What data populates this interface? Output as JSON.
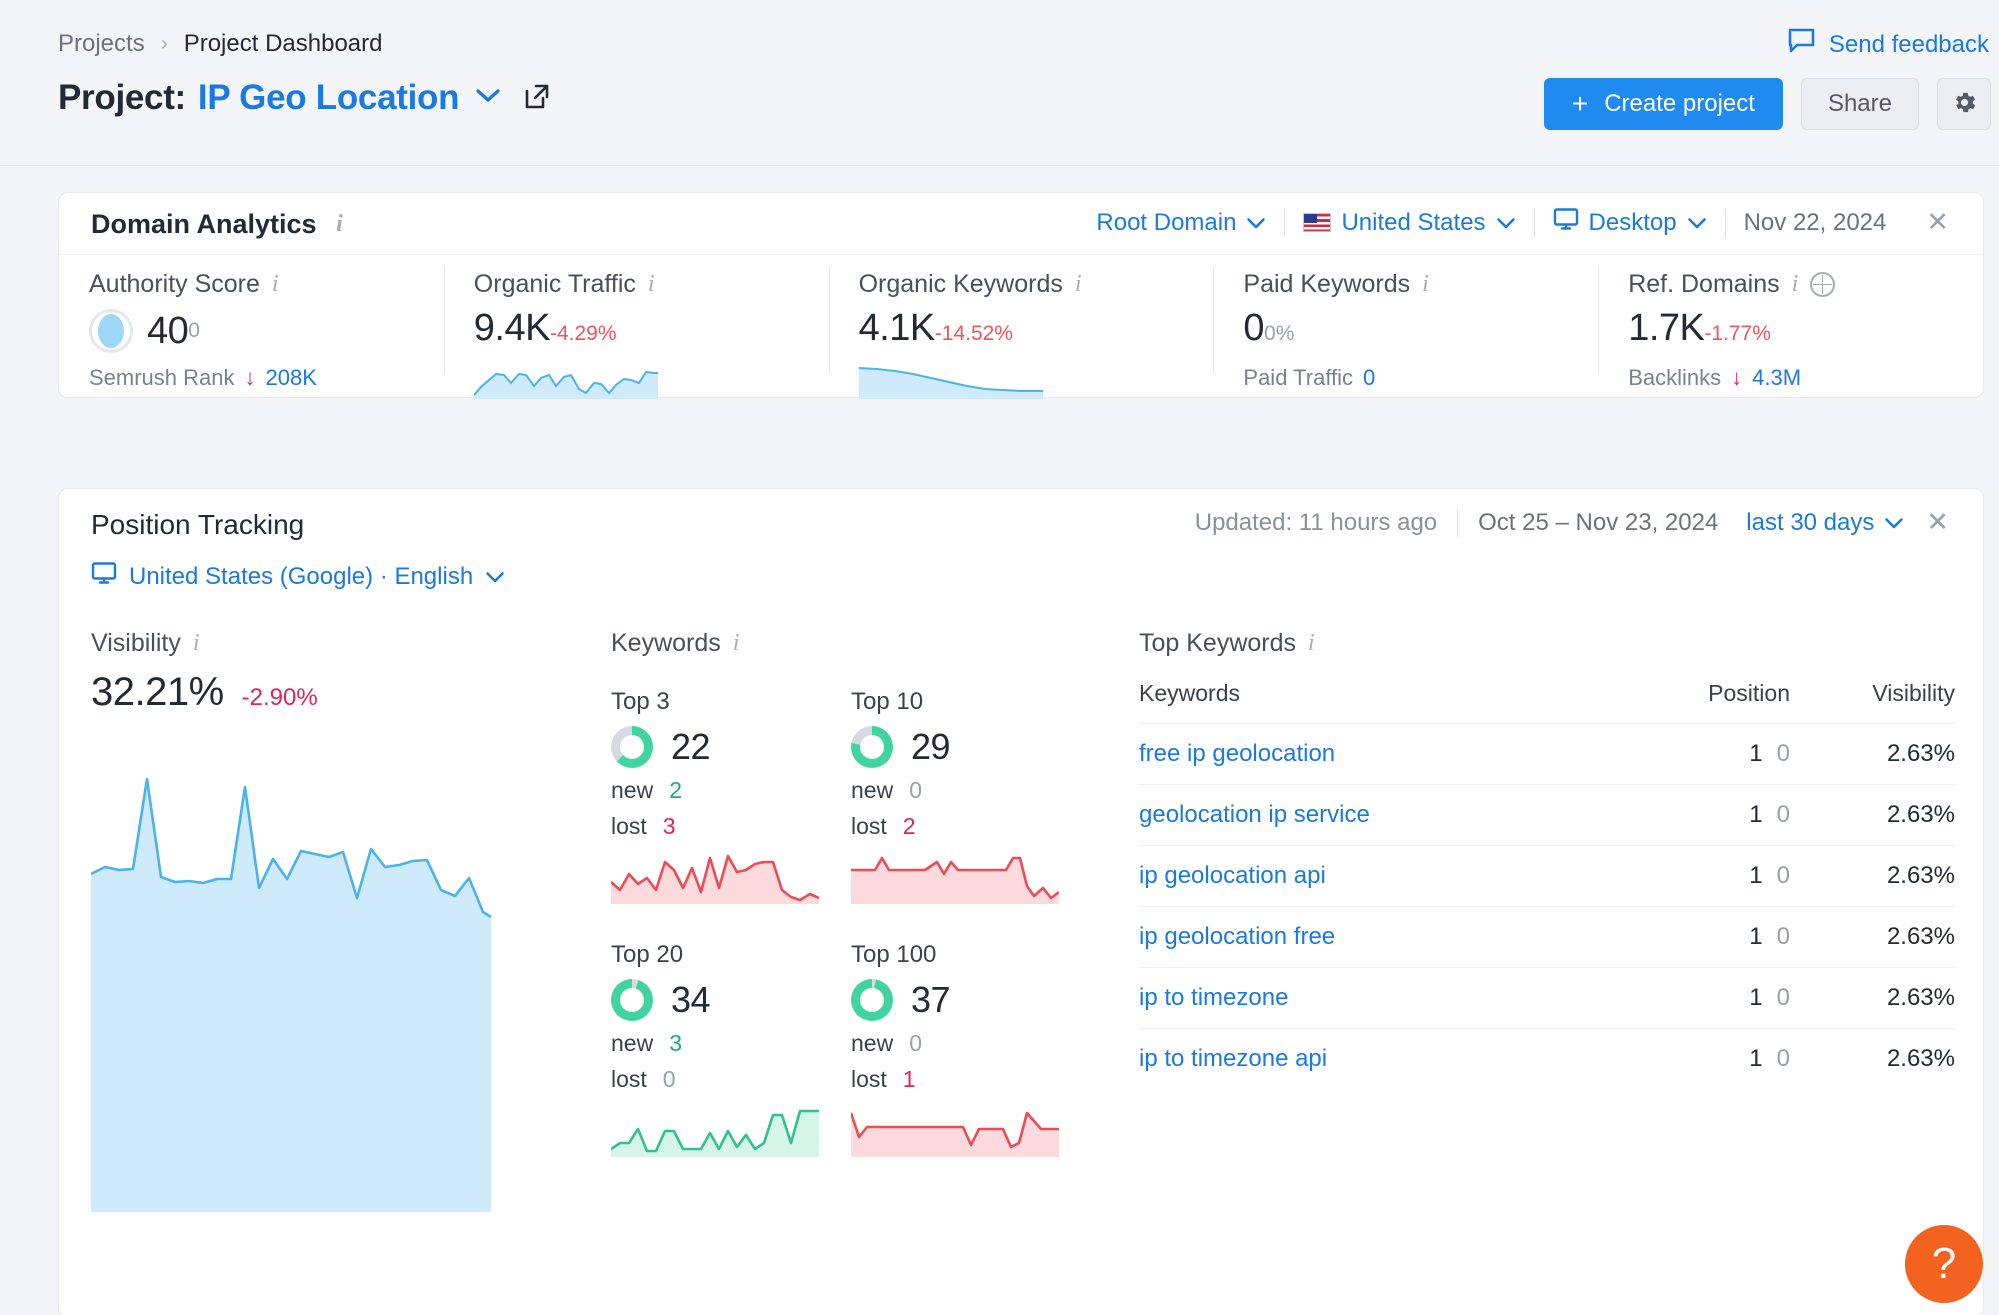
{
  "header": {
    "breadcrumb": {
      "root": "Projects",
      "separator": "›",
      "current": "Project Dashboard"
    },
    "title_prefix": "Project:",
    "project_name": "IP Geo Location",
    "caret_icon": "chevron-down-icon",
    "external_link_icon": "external-link-icon",
    "feedback_label": "Send feedback",
    "feedback_icon": "speech-bubble-icon",
    "create_project_label": "Create project",
    "create_plus": "+",
    "share_label": "Share",
    "gear_icon": "gear-icon",
    "accent_blue": "#1f8af0"
  },
  "domain_analytics": {
    "title": "Domain Analytics",
    "info_icon": "info-icon",
    "controls": {
      "scope": "Root Domain",
      "country": "United States",
      "country_flag": "us-flag-icon",
      "device": "Desktop",
      "device_icon": "monitor-icon",
      "date": "Nov 22, 2024",
      "close_icon": "close-icon"
    },
    "metrics": [
      {
        "label": "Authority Score",
        "value": "40",
        "sub": "0",
        "sub_kind": "grey",
        "gauge": true,
        "foot_label": "Semrush Rank",
        "foot_arrow": "↓",
        "foot_value": "208K",
        "sparkline": null
      },
      {
        "label": "Organic Traffic",
        "value": "9.4K",
        "sub": "-4.29%",
        "sub_kind": "neg",
        "gauge": false,
        "foot_label": "",
        "foot_value": "",
        "sparkline": "organic-traffic-sparkline"
      },
      {
        "label": "Organic Keywords",
        "value": "4.1K",
        "sub": "-14.52%",
        "sub_kind": "neg",
        "gauge": false,
        "foot_label": "",
        "foot_value": "",
        "sparkline": "organic-keywords-sparkline"
      },
      {
        "label": "Paid Keywords",
        "value": "0",
        "sub": "0%",
        "sub_kind": "grey",
        "gauge": false,
        "foot_label": "Paid Traffic",
        "foot_arrow": "",
        "foot_value": "0",
        "sparkline": null
      },
      {
        "label": "Ref. Domains",
        "value": "1.7K",
        "sub": "-1.77%",
        "sub_kind": "neg",
        "gauge": false,
        "foot_label": "Backlinks",
        "foot_arrow": "↓",
        "foot_value": "4.3M",
        "sparkline": null,
        "extra_icon": "globe-icon"
      }
    ]
  },
  "position_tracking": {
    "title": "Position Tracking",
    "engine": "United States (Google) · English",
    "engine_icon": "monitor-icon",
    "updated": "Updated: 11 hours ago",
    "date_range": "Oct 25 – Nov 23, 2024",
    "period": "last 30 days",
    "close_icon": "close-icon",
    "visibility": {
      "label": "Visibility",
      "value": "32.21%",
      "delta": "-2.90%"
    },
    "keywords": {
      "label": "Keywords",
      "buckets": [
        {
          "label": "Top 3",
          "count": "22",
          "new": "2",
          "lost": "3",
          "donut_pct": 63,
          "spark": "red"
        },
        {
          "label": "Top 10",
          "count": "29",
          "new": "0",
          "lost": "2",
          "donut_pct": 78,
          "spark": "red"
        },
        {
          "label": "Top 20",
          "count": "34",
          "new": "3",
          "lost": "0",
          "donut_pct": 94,
          "spark": "green"
        },
        {
          "label": "Top 100",
          "count": "37",
          "new": "0",
          "lost": "1",
          "donut_pct": 97,
          "spark": "red"
        }
      ]
    },
    "top_keywords": {
      "label": "Top Keywords",
      "columns": [
        "Keywords",
        "Position",
        "Visibility"
      ],
      "rows": [
        {
          "keyword": "free ip geolocation",
          "pos": "1",
          "pos_prev": "0",
          "visibility": "2.63%"
        },
        {
          "keyword": "geolocation ip service",
          "pos": "1",
          "pos_prev": "0",
          "visibility": "2.63%"
        },
        {
          "keyword": "ip geolocation api",
          "pos": "1",
          "pos_prev": "0",
          "visibility": "2.63%"
        },
        {
          "keyword": "ip geolocation free",
          "pos": "1",
          "pos_prev": "0",
          "visibility": "2.63%"
        },
        {
          "keyword": "ip to timezone",
          "pos": "1",
          "pos_prev": "0",
          "visibility": "2.63%"
        },
        {
          "keyword": "ip to timezone api",
          "pos": "1",
          "pos_prev": "0",
          "visibility": "2.63%"
        }
      ]
    }
  },
  "help": {
    "label": "?",
    "color": "#f4621f"
  },
  "chart_data": [
    {
      "type": "area",
      "title": "Visibility",
      "name": "visibility-trend",
      "ylabel": "Visibility %",
      "ylim": [
        0,
        45
      ],
      "values": [
        33.5,
        34.2,
        33.6,
        44.0,
        32.6,
        33.0,
        32.8,
        33.2,
        33.4,
        41.5,
        33.0,
        35.8,
        33.3,
        36.2,
        36.0,
        35.5,
        36.0,
        31.4,
        36.4,
        34.9,
        35.0,
        35.4,
        35.2,
        32.0,
        31.3,
        33.8,
        29.9,
        32.21
      ]
    },
    {
      "type": "area",
      "name": "organic-traffic-sparkline",
      "title": "Organic Traffic",
      "values": [
        22,
        40,
        58,
        72,
        70,
        48,
        72,
        70,
        44,
        66,
        70,
        40,
        64,
        68,
        34,
        26,
        48,
        46,
        26,
        44,
        58,
        56,
        50,
        76,
        74
      ]
    },
    {
      "type": "area",
      "name": "organic-keywords-sparkline",
      "title": "Organic Keywords",
      "values": [
        78,
        76,
        73,
        68,
        62,
        54,
        45,
        36,
        28,
        22,
        20,
        19,
        18,
        18,
        17
      ]
    },
    {
      "type": "area",
      "name": "top3-sparkline",
      "title": "Top 3",
      "values": [
        30,
        22,
        40,
        28,
        34,
        22,
        62,
        52,
        26,
        54,
        20,
        70,
        26,
        74,
        48,
        52,
        60,
        62,
        62,
        22,
        12,
        8,
        16
      ]
    },
    {
      "type": "area",
      "name": "top10-sparkline",
      "title": "Top 10",
      "values": [
        62,
        62,
        62,
        80,
        62,
        62,
        62,
        62,
        74,
        54,
        74,
        62,
        62,
        62,
        62,
        62,
        80,
        80,
        36,
        20,
        30,
        14
      ]
    },
    {
      "type": "area",
      "name": "top20-sparkline",
      "title": "Top 20",
      "values": [
        14,
        22,
        22,
        42,
        12,
        12,
        40,
        40,
        16,
        16,
        16,
        38,
        16,
        40,
        18,
        36,
        16,
        22,
        70,
        70,
        22,
        78,
        78,
        78
      ]
    },
    {
      "type": "area",
      "name": "top100-sparkline",
      "title": "Top 100",
      "values": [
        74,
        28,
        52,
        52,
        52,
        52,
        52,
        52,
        52,
        52,
        52,
        52,
        52,
        14,
        48,
        48,
        48,
        48,
        14,
        40,
        78,
        44,
        44
      ]
    }
  ]
}
